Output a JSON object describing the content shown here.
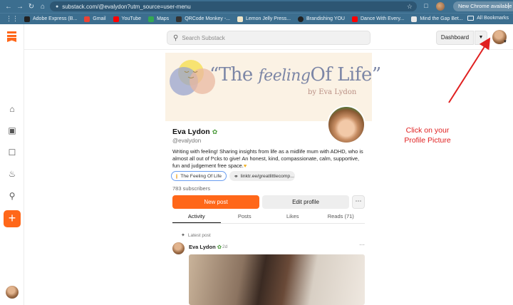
{
  "browser": {
    "url": "substack.com/@evalydon?utm_source=user-menu",
    "update_label": "New Chrome available",
    "bookmarks": [
      {
        "label": "Adobe Express (B...",
        "color": "#222222"
      },
      {
        "label": "Gmail",
        "color": "#ea4335"
      },
      {
        "label": "YouTube",
        "color": "#ff0000"
      },
      {
        "label": "Maps",
        "color": "#34a853"
      },
      {
        "label": "QRCode Monkey -...",
        "color": "#333333"
      },
      {
        "label": "Lemon Jelly Press...",
        "color": "#f0e6c8"
      },
      {
        "label": "Brandishing YOU",
        "color": "#222222"
      },
      {
        "label": "Dance With Every...",
        "color": "#ff0000"
      },
      {
        "label": "Mind the Gap Bet...",
        "color": "#e8e8e8"
      }
    ],
    "all_bookmarks_label": "All Bookmarks"
  },
  "topbar": {
    "search_placeholder": "Search Substack",
    "dashboard_label": "Dashboard"
  },
  "banner": {
    "title_the": "“The ",
    "title_feeling": "feeling",
    "title_rest": "Of Life”",
    "byline": "by Eva Lydon"
  },
  "profile": {
    "name": "Eva Lydon",
    "handle": "@evalydon",
    "bio": "Writing with feeling! Sharing insights from life as a midlife mum with ADHD, who is almost all out of f*cks to give! An honest, kind, compassionate, calm, supportive, fun and judgement free space.",
    "publication": "The Feeling Of Life",
    "link": "linktr.ee/greatlittlecomp...",
    "subscribers": "783 subscribers",
    "new_post_label": "New post",
    "edit_profile_label": "Edit profile"
  },
  "tabs": [
    {
      "label": "Activity",
      "active": true
    },
    {
      "label": "Posts",
      "active": false
    },
    {
      "label": "Likes",
      "active": false
    },
    {
      "label": "Reads (71)",
      "active": false
    }
  ],
  "feed": {
    "latest_label": "Latest post",
    "author": "Eva Lydon",
    "age": "2d"
  },
  "annotation": {
    "line1": "Click on your",
    "line2": "Profile Picture",
    "color": "#e02020"
  },
  "colors": {
    "accent": "#ff6719",
    "chrome": "#3c6e8f"
  }
}
